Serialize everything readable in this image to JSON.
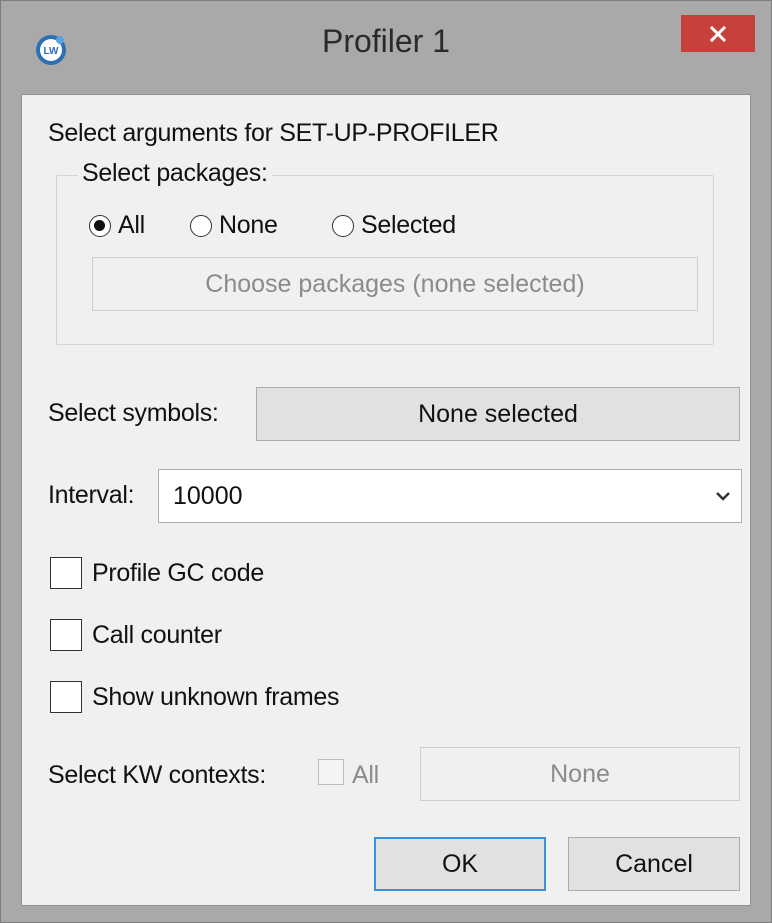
{
  "window": {
    "title": "Profiler 1",
    "icon": "lw-app-icon",
    "close_icon": "close-icon"
  },
  "prompt": "Select arguments for SET-UP-PROFILER",
  "packages": {
    "group_label": "Select packages:",
    "options": [
      {
        "label": "All",
        "selected": true
      },
      {
        "label": "None",
        "selected": false
      },
      {
        "label": "Selected",
        "selected": false
      }
    ],
    "choose_button": "Choose packages (none selected)"
  },
  "symbols": {
    "label": "Select symbols:",
    "button": "None selected"
  },
  "interval": {
    "label": "Interval:",
    "value": "10000"
  },
  "options": [
    {
      "label": "Profile GC code",
      "checked": false
    },
    {
      "label": "Call counter",
      "checked": false
    },
    {
      "label": "Show unknown frames",
      "checked": false
    }
  ],
  "kw_contexts": {
    "label": "Select KW contexts:",
    "all_label": "All",
    "button": "None"
  },
  "buttons": {
    "ok": "OK",
    "cancel": "Cancel"
  },
  "colors": {
    "close_button": "#c7403a",
    "default_button_border": "#3c8fd8",
    "client_background": "#f0f0f0"
  }
}
